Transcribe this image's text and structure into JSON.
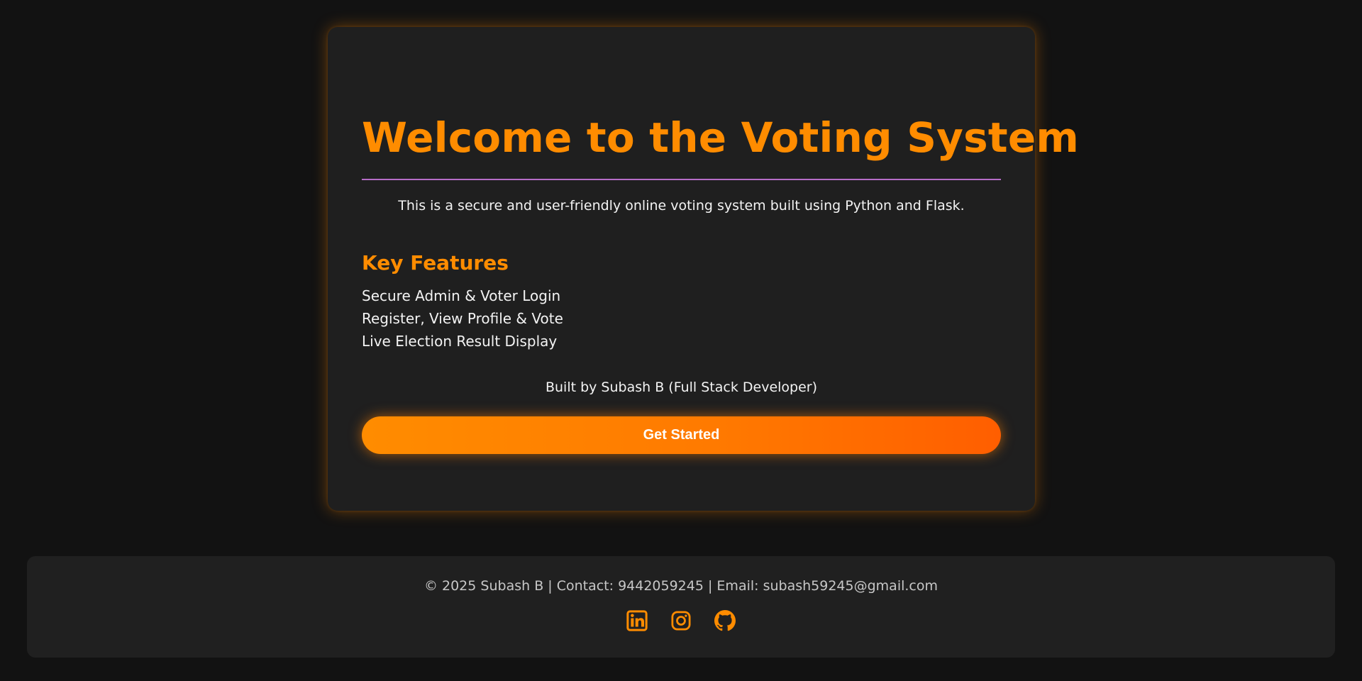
{
  "hero": {
    "title": "Welcome to the Voting System",
    "intro": "This is a secure and user-friendly online voting system built using Python and Flask.",
    "features_title": "Key Features",
    "features": [
      "Secure Admin & Voter Login",
      "Register, View Profile & Vote",
      "Live Election Result Display"
    ],
    "built_by": "Built by Subash B (Full Stack Developer)",
    "cta_label": "Get Started"
  },
  "footer": {
    "text": "© 2025 Subash B | Contact: 9442059245 | Email: subash59245@gmail.com",
    "social_icons": [
      "linkedin-icon",
      "instagram-icon",
      "github-icon"
    ]
  },
  "colors": {
    "page_background": "#121212",
    "card_background": "#1f1f1f",
    "accent": "#ff8c00",
    "accent_end": "#ff5e00",
    "divider": "#b56cc7",
    "body_text": "#f3f3f3",
    "footer_text": "#c7c7c7"
  }
}
